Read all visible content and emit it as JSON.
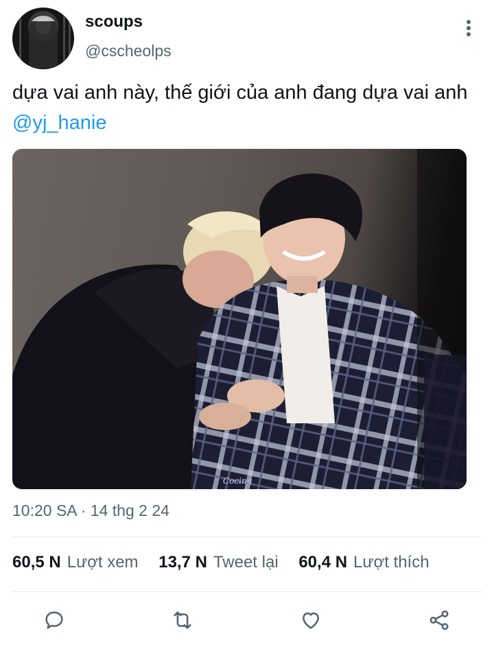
{
  "author": {
    "display_name": "scoups",
    "handle": "@cscheolps",
    "avatar_icon": "profile-photo"
  },
  "tweet": {
    "text": "dựa vai anh này, thế giới của anh đang dựa vai anh ",
    "mention": "@yj_hanie",
    "media_watermark": "Cocing",
    "timestamp": "10:20 SA · 14 thg 2 24"
  },
  "stats": [
    {
      "value": "60,5 N",
      "label": "Lượt xem"
    },
    {
      "value": "13,7 N",
      "label": "Tweet lại"
    },
    {
      "value": "60,4 N",
      "label": "Lượt thích"
    }
  ],
  "actions": [
    "reply-icon",
    "retweet-icon",
    "like-icon",
    "share-icon"
  ],
  "colors": {
    "link": "#1d9bf0",
    "secondary_text": "#536471",
    "primary_text": "#0f1419",
    "divider": "#e5e8eb",
    "icon": "#536471"
  }
}
